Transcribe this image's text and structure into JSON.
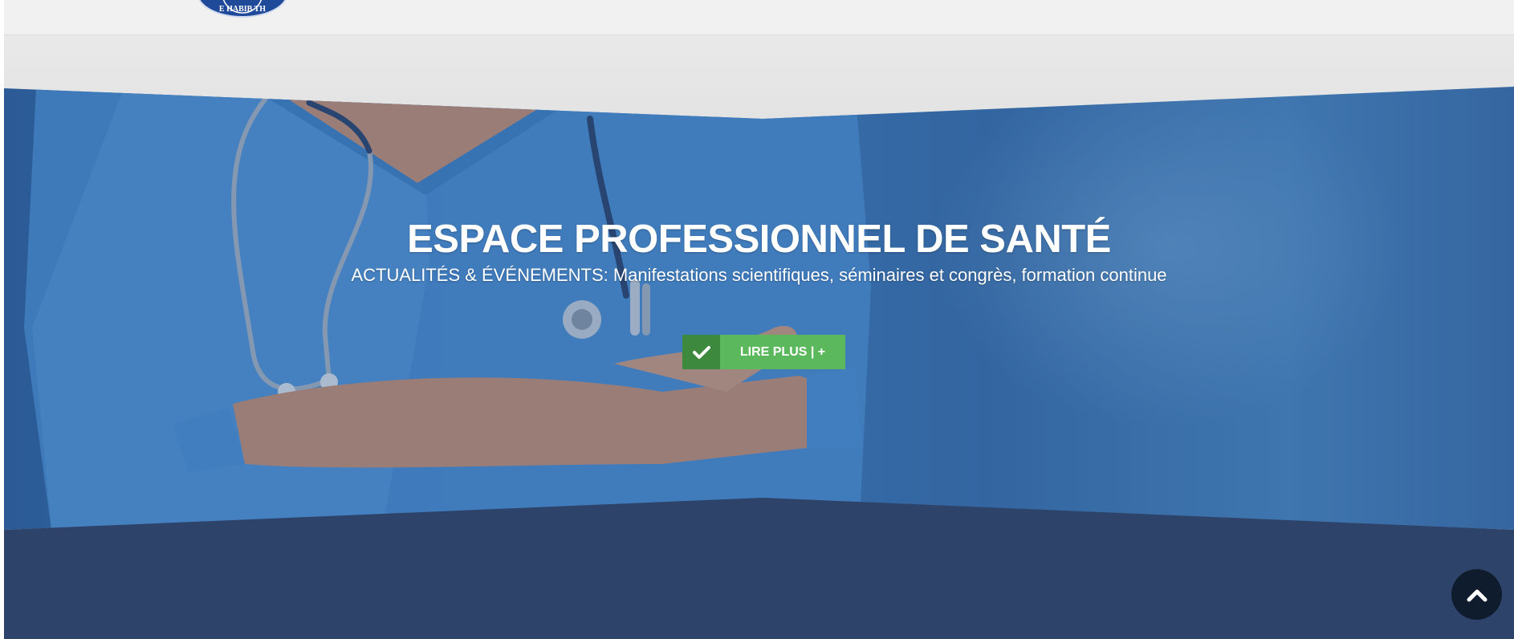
{
  "header": {
    "logo_icon": "circular-seal-logo",
    "logo_text": "E HABIB TH"
  },
  "hero": {
    "title": "ESPACE PROFESSIONNEL DE SANTÉ",
    "subtitle": "ACTUALITÉS & ÉVÉNEMENTS: Manifestations scientifiques, séminaires et congrès, formation continue",
    "cta": {
      "icon": "check-icon",
      "label": "LIRE PLUS | +"
    }
  },
  "scroll_top": {
    "icon": "chevron-up-icon"
  },
  "colors": {
    "header_bg": "#f1f1f1",
    "hero_blue": "#3a73b0",
    "cta_green": "#5cb85c",
    "cta_icon_green": "#3d8a3f",
    "footer_navy": "#2e4369",
    "scroll_top_bg": "#0f1c2e"
  }
}
